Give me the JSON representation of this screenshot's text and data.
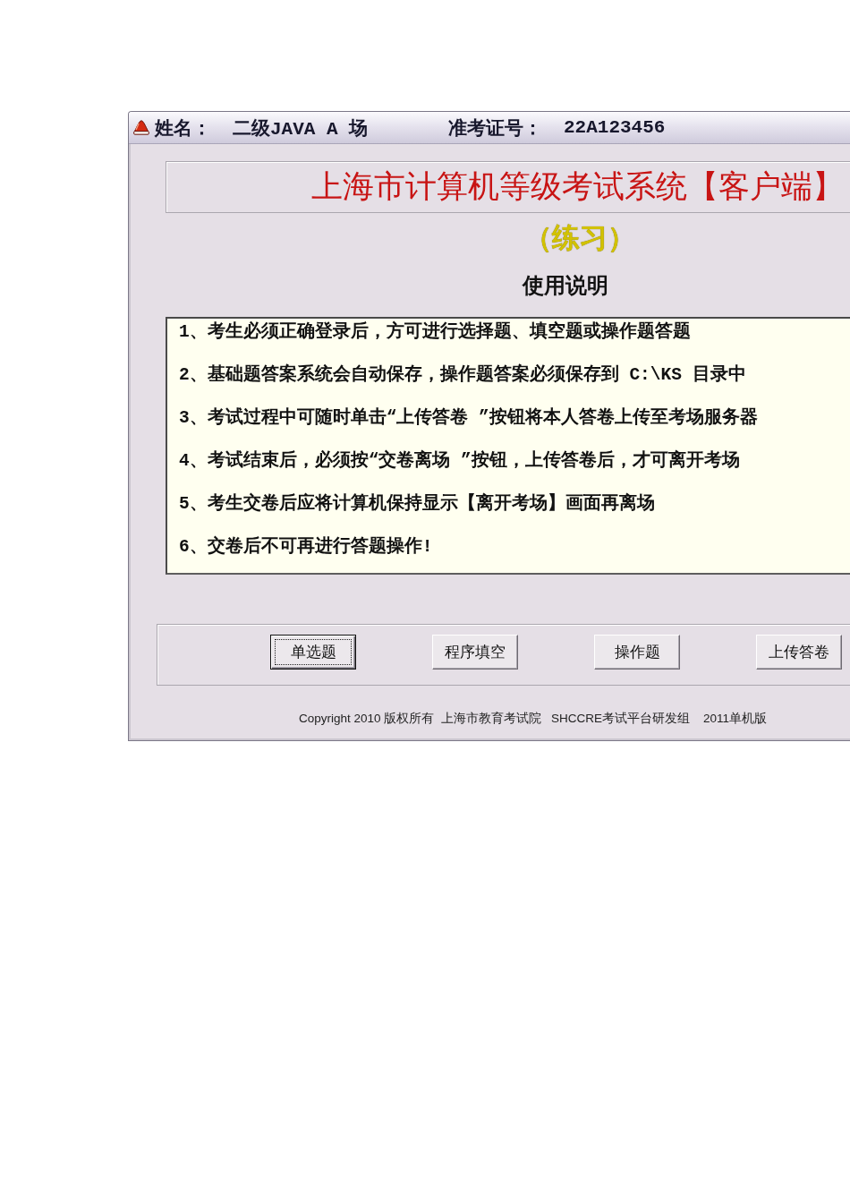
{
  "title_bar": {
    "fields": [
      {
        "label": "姓名：",
        "value": "二级JAVA A 场"
      },
      {
        "label": "准考证号：",
        "value": "22A123456"
      }
    ]
  },
  "header": {
    "title": "上海市计算机等级考试系统【客户端】",
    "mode": "（练习）",
    "subtitle": "使用说明"
  },
  "instructions": [
    "1、考生必须正确登录后，方可进行选择题、填空题或操作题答题",
    "2、基础题答案系统会自动保存，操作题答案必须保存到 C:\\KS 目录中",
    "3、考试过程中可随时单击“上传答卷 ”按钮将本人答卷上传至考场服务器",
    "4、考试结束后，必须按“交卷离场 ”按钮，上传答卷后，才可离开考场",
    "5、考生交卷后应将计算机保持显示【离开考场】画面再离场",
    "6、交卷后不可再进行答题操作!"
  ],
  "buttons": [
    {
      "label": "单选题",
      "focused": true
    },
    {
      "label": "程序填空",
      "focused": false
    },
    {
      "label": "操作题",
      "focused": false
    },
    {
      "label": "上传答卷",
      "focused": false
    }
  ],
  "footer": {
    "copyright": "Copyright 2010 版权所有  上海市教育考试院   SHCCRE考试平台研发组    2011单机版"
  }
}
